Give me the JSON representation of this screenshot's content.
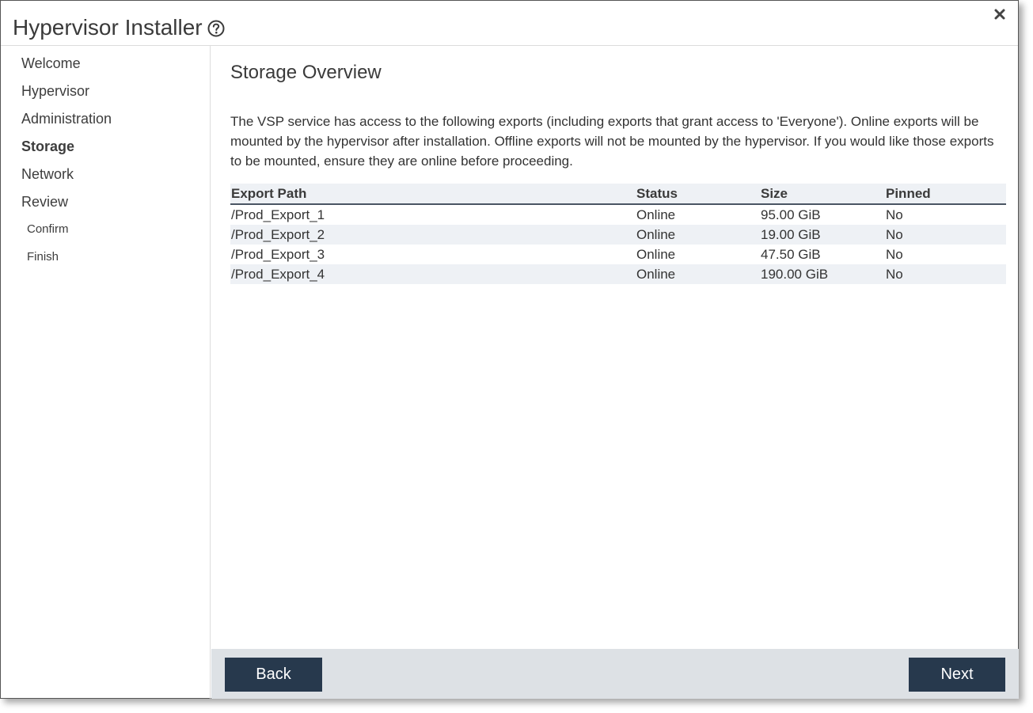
{
  "window": {
    "title": "Hypervisor Installer",
    "help_icon": "question-circle-icon",
    "close_icon": "close-x-icon"
  },
  "sidebar": {
    "items": [
      {
        "label": "Welcome",
        "active": false
      },
      {
        "label": "Hypervisor",
        "active": false
      },
      {
        "label": "Administration",
        "active": false
      },
      {
        "label": "Storage",
        "active": true
      },
      {
        "label": "Network",
        "active": false
      },
      {
        "label": "Review",
        "active": false
      }
    ],
    "subitems": [
      {
        "label": "Confirm"
      },
      {
        "label": "Finish"
      }
    ]
  },
  "main": {
    "title": "Storage Overview",
    "description": "The VSP service has access to the following exports (including exports that grant access to 'Everyone'). Online exports will be mounted by the hypervisor after installation. Offline exports will not be mounted by the hypervisor. If you would like those exports to be mounted, ensure they are online before proceeding.",
    "table": {
      "columns": [
        "Export Path",
        "Status",
        "Size",
        "Pinned"
      ],
      "rows": [
        [
          "/Prod_Export_1",
          "Online",
          "95.00 GiB",
          "No"
        ],
        [
          "/Prod_Export_2",
          "Online",
          "19.00 GiB",
          "No"
        ],
        [
          "/Prod_Export_3",
          "Online",
          "47.50 GiB",
          "No"
        ],
        [
          "/Prod_Export_4",
          "Online",
          "190.00 GiB",
          "No"
        ]
      ]
    }
  },
  "footer": {
    "back_label": "Back",
    "next_label": "Next"
  },
  "colors": {
    "button_bg": "#27394d",
    "footer_bg": "#dde1e5",
    "row_alt_bg": "#eef1f5"
  }
}
